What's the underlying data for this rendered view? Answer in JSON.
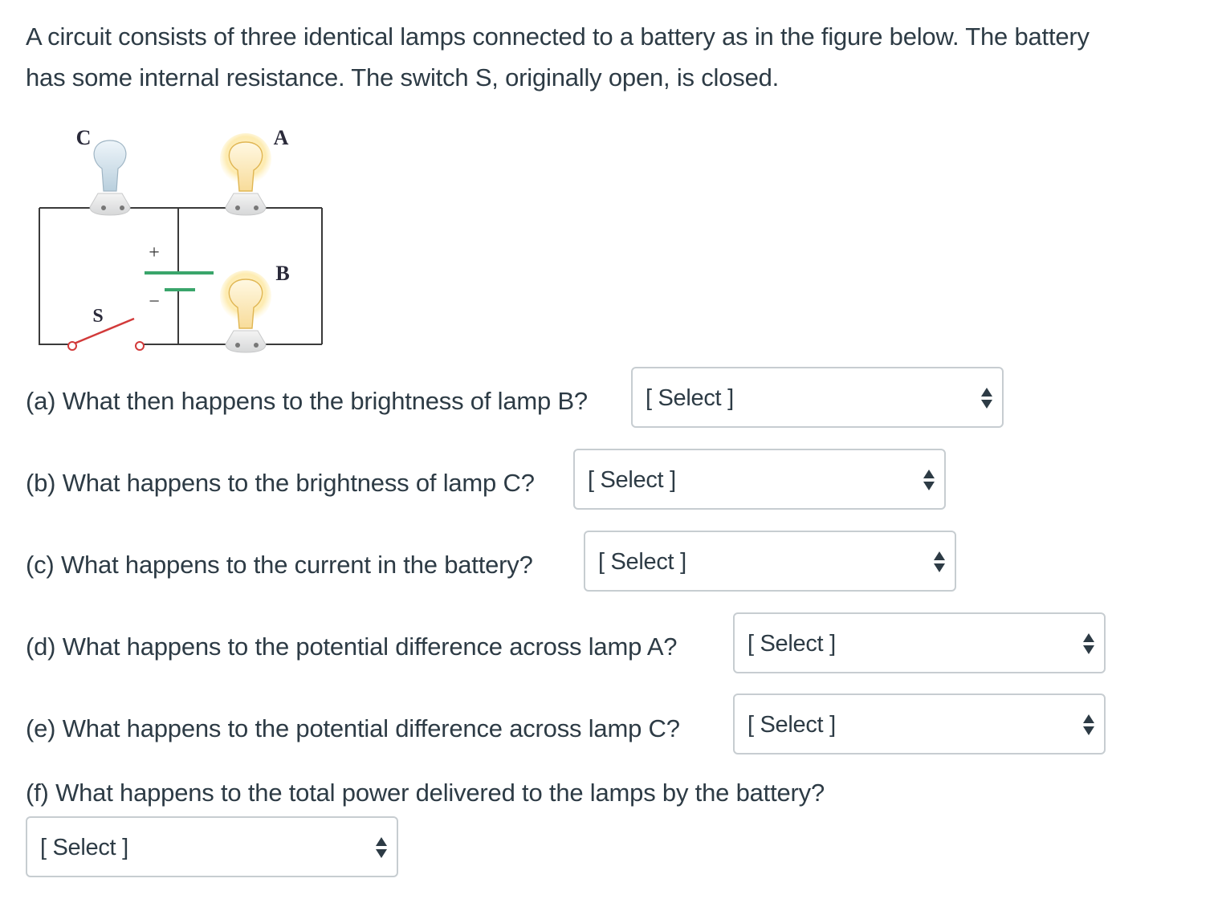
{
  "intro": {
    "line1": "A circuit consists of three identical lamps connected to a battery as in the figure below. The battery",
    "line2": "has some internal resistance. The switch S, originally open, is closed."
  },
  "figure": {
    "labels": {
      "lamp_c": "C",
      "lamp_a": "A",
      "lamp_b": "B",
      "switch": "S",
      "plus": "+",
      "minus": "−"
    },
    "colors": {
      "wire": "#3a3a3a",
      "battery": "#3aa56b",
      "switch": "#d23a3a",
      "lit_bulb": "#fbe6b0",
      "lit_glow": "#fff3c4",
      "unlit_bulb": "#cfe0ec",
      "socket": "#e9eaeb"
    },
    "lamp_states": {
      "A": "lit",
      "B": "lit",
      "C": "unlit"
    }
  },
  "questions": [
    {
      "id": "a",
      "text": "(a) What then happens to the brightness of lamp B?",
      "select_value": "[ Select ]"
    },
    {
      "id": "b",
      "text": "(b) What happens to the brightness of lamp C?",
      "select_value": "[ Select ]"
    },
    {
      "id": "c",
      "text": "(c) What happens to the current in the battery?",
      "select_value": "[ Select ]"
    },
    {
      "id": "d",
      "text": "(d) What happens to the potential difference across lamp A?",
      "select_value": "[ Select ]"
    },
    {
      "id": "e",
      "text": "(e) What happens to the potential difference across lamp C?",
      "select_value": "[ Select ]"
    },
    {
      "id": "f",
      "text": "(f) What happens to the total power delivered to the lamps by the battery?",
      "select_value": "[ Select ]"
    }
  ]
}
